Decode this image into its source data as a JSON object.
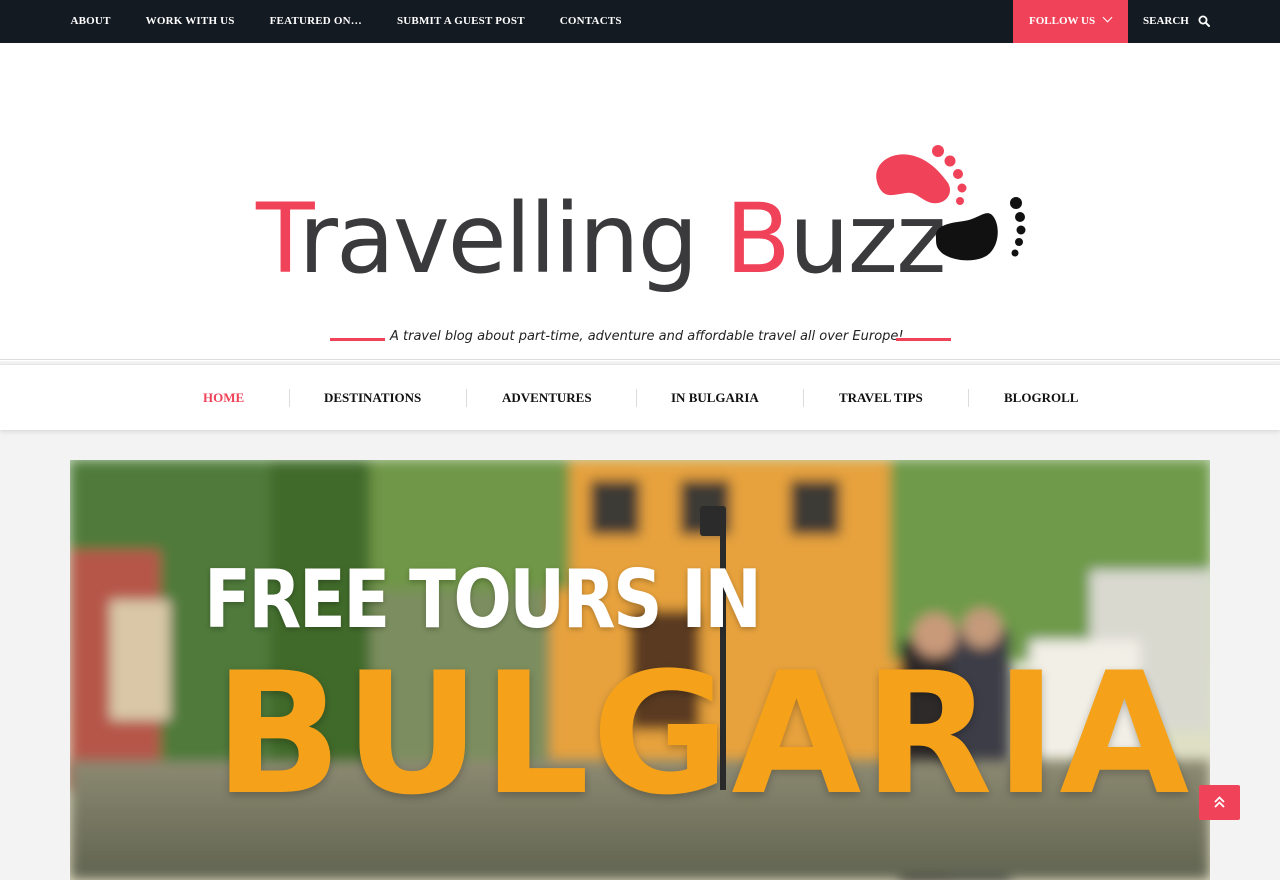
{
  "top_nav": {
    "items": [
      "ABOUT",
      "WORK WITH US",
      "FEATURED ON…",
      "SUBMIT A GUEST POST",
      "CONTACTS"
    ],
    "follow_label": "FOLLOW US",
    "search_label": "SEARCH"
  },
  "header": {
    "logo_text_part1": "T",
    "logo_text_part2": "ravelling ",
    "logo_text_part3": "B",
    "logo_text_part4": "uzz",
    "tagline": "A travel blog about part-time, adventure and affordable travel all over Europe!"
  },
  "main_nav": {
    "items": [
      {
        "label": "HOME",
        "active": true
      },
      {
        "label": "DESTINATIONS",
        "active": false
      },
      {
        "label": "ADVENTURES",
        "active": false
      },
      {
        "label": "IN BULGARIA",
        "active": false
      },
      {
        "label": "TRAVEL TIPS",
        "active": false
      },
      {
        "label": "BLOGROLL",
        "active": false
      }
    ]
  },
  "hero": {
    "line1": "FREE TOURS IN",
    "line2": "BULGARIA"
  },
  "colors": {
    "accent": "#f0435a",
    "topbar": "#141a22",
    "hero_text_yellow": "#f5a21a"
  },
  "icons": {
    "search": "search-icon",
    "follow_chevron": "chevron-down-icon",
    "back_to_top": "double-chevron-up-icon",
    "logo_feet": "footprints-icon"
  }
}
